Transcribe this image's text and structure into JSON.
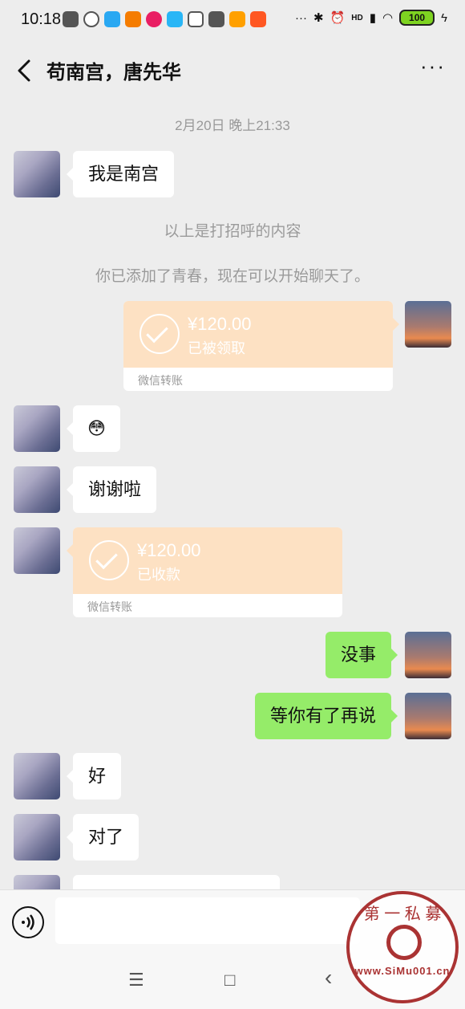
{
  "status_bar": {
    "time": "10:18",
    "battery": "100",
    "network": "HD"
  },
  "header": {
    "title": "苟南宫，唐先华",
    "more": "···"
  },
  "messages": {
    "timestamp": "2月20日 晚上21:33",
    "m1": "我是南宫",
    "sys1": "以上是打招呼的内容",
    "sys2": "你已添加了青春，现在可以开始聊天了。",
    "t1_amount": "¥120.00",
    "t1_status": "已被领取",
    "t1_label": "微信转账",
    "m2": "😳",
    "m3": "谢谢啦",
    "t2_amount": "¥120.00",
    "t2_status": "已收款",
    "t2_label": "微信转账",
    "m4": "没事",
    "m5": "等你有了再说",
    "m6": "好",
    "m7": "对了"
  },
  "nav": {
    "menu": "☰",
    "home": "□",
    "back": "‹"
  },
  "watermark": {
    "top_text": "第 一 私 募",
    "url": "www.SiMu001.cn"
  }
}
